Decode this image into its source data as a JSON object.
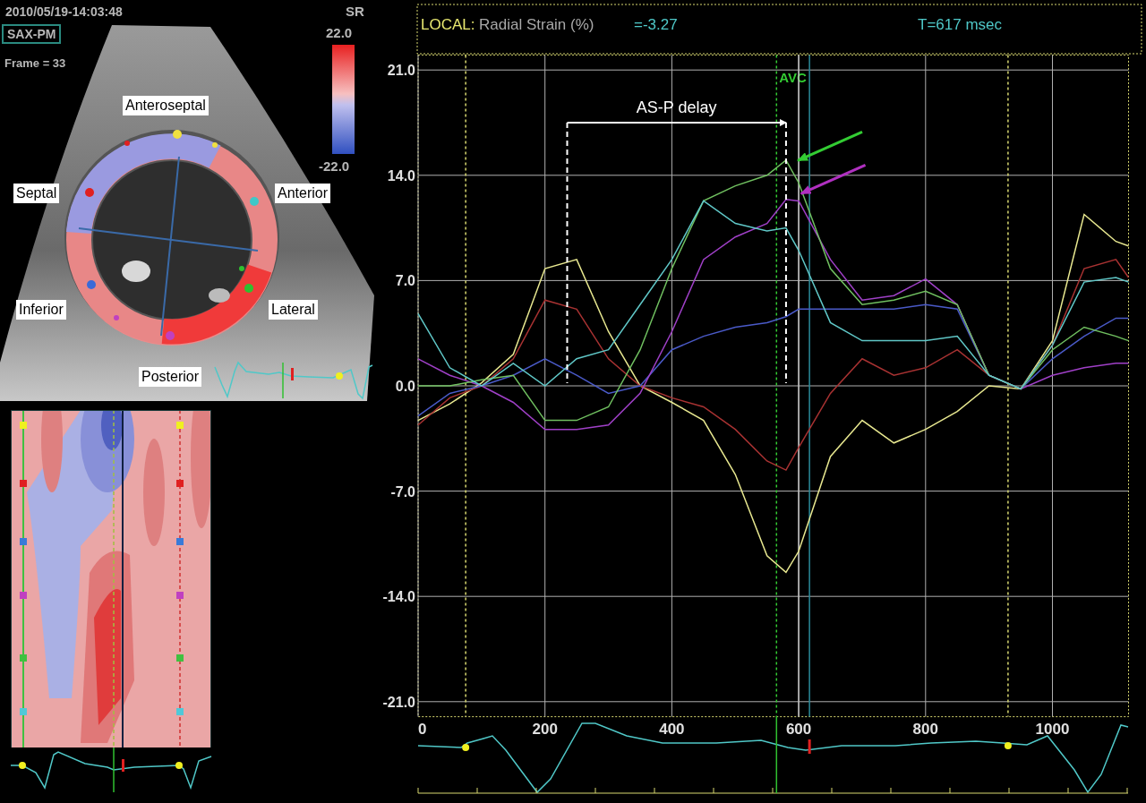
{
  "ultrasound": {
    "timestamp": "2010/05/19-14:03:48",
    "view": "SAX-PM",
    "frame": "Frame = 33",
    "scale": {
      "title": "SR",
      "max": "22.0",
      "min": "-22.0"
    },
    "segments": [
      "Anteroseptal",
      "Septal",
      "Anterior",
      "Inferior",
      "Lateral",
      "Posterior"
    ]
  },
  "strain_panel": {
    "header": {
      "mode": "LOCAL:",
      "measure": "Radial Strain (%)",
      "value": "=-3.27",
      "time": "T=617 msec"
    },
    "chart_data": {
      "type": "line",
      "x": [
        0,
        50,
        100,
        150,
        200,
        250,
        300,
        350,
        400,
        450,
        500,
        550,
        580,
        600,
        650,
        700,
        750,
        800,
        850,
        900,
        950,
        1000,
        1050,
        1100,
        1120
      ],
      "series": [
        {
          "color": "#e8e890",
          "values": [
            -2.3,
            -1.2,
            0.2,
            2.1,
            7.8,
            8.4,
            3.6,
            0,
            -1.1,
            -2.3,
            -5.9,
            -11.3,
            -12.4,
            -11,
            -4.7,
            -2.3,
            -3.8,
            -2.9,
            -1.7,
            0,
            -0.2,
            3,
            11.4,
            9.6,
            9.3
          ]
        },
        {
          "color": "#a83232",
          "values": [
            -2.6,
            -0.8,
            0,
            1.8,
            5.7,
            5.1,
            1.8,
            0,
            -0.8,
            -1.4,
            -2.9,
            -5,
            -5.6,
            -4.1,
            -0.5,
            1.8,
            0.7,
            1.2,
            2.4,
            0.7,
            -0.2,
            2.7,
            7.8,
            8.4,
            7.2
          ]
        },
        {
          "color": "#4a5ac8",
          "values": [
            -2,
            -0.5,
            0,
            0.7,
            1.8,
            0.7,
            -0.5,
            0,
            2.4,
            3.3,
            3.9,
            4.2,
            4.6,
            5.1,
            5.1,
            5.1,
            5.1,
            5.4,
            5.1,
            0.7,
            -0.2,
            1.8,
            3.3,
            4.5,
            4.5
          ]
        },
        {
          "color": "#a040c8",
          "values": [
            1.8,
            0.7,
            0,
            -1.1,
            -2.9,
            -2.9,
            -2.6,
            -0.5,
            3.6,
            8.4,
            9.9,
            10.8,
            12.4,
            12.3,
            8.4,
            5.7,
            6,
            7.1,
            5.4,
            0.7,
            -0.2,
            0.7,
            1.2,
            1.5,
            1.5
          ]
        },
        {
          "color": "#70c060",
          "values": [
            0,
            0,
            0.4,
            0.7,
            -2.3,
            -2.3,
            -1.4,
            2.4,
            7.8,
            12.3,
            13.3,
            14,
            15,
            13.5,
            7.8,
            5.4,
            5.7,
            6.3,
            5.4,
            0.7,
            -0.2,
            2.4,
            3.9,
            3.3,
            3
          ]
        },
        {
          "color": "#60c8c8",
          "values": [
            4.8,
            1.2,
            0,
            1.5,
            0,
            1.8,
            2.4,
            5.4,
            8.4,
            12.3,
            10.8,
            10.3,
            10.5,
            9,
            4.2,
            3,
            3,
            3,
            3.3,
            0.7,
            -0.2,
            2.7,
            6.9,
            7.2,
            6.9
          ]
        }
      ],
      "xlim": [
        0,
        1120
      ],
      "ylim": [
        -22,
        22
      ],
      "xticks": [
        0,
        200,
        400,
        600,
        800,
        1000
      ],
      "yticks": [
        {
          "value": 21,
          "label": "21.0"
        },
        {
          "value": 14,
          "label": "14.0"
        },
        {
          "value": 7,
          "label": "7.0"
        },
        {
          "value": 0,
          "label": "0.0"
        },
        {
          "value": -7,
          "label": "-7.0"
        },
        {
          "value": -14,
          "label": "-14.0"
        },
        {
          "value": -21,
          "label": "-21.0"
        }
      ],
      "grid": true,
      "ref_lines": [
        {
          "axis": "x",
          "value": 75,
          "color": "#d8d870"
        },
        {
          "axis": "x",
          "value": 565,
          "label": "AVC",
          "color": "#33cc33"
        },
        {
          "axis": "x",
          "value": 600,
          "color": "#c0c0c0"
        },
        {
          "axis": "x",
          "value": 617,
          "color": "#2a8a9a"
        },
        {
          "axis": "x",
          "value": 930,
          "color": "#d8d870"
        }
      ],
      "annotations": [
        "AS-P delay"
      ]
    }
  }
}
